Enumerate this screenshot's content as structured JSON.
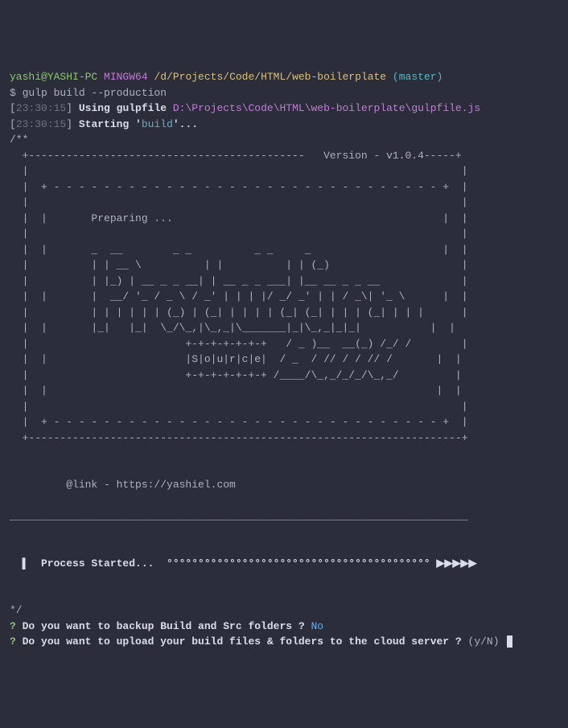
{
  "prompt": {
    "user": "yashi@YASHI-PC",
    "env": "MINGW64",
    "cwd": "/d/Projects/Code/HTML/web-boilerplate",
    "branch_open": "(",
    "branch": "master",
    "branch_close": ")"
  },
  "command": {
    "symbol": "$ ",
    "text": "gulp build --production"
  },
  "log1": {
    "lb": "[",
    "time": "23:30:15",
    "rb": "] ",
    "msg": "Using gulpfile ",
    "path": "D:\\Projects\\Code\\HTML\\web-boilerplate\\gulpfile.js"
  },
  "log2": {
    "lb": "[",
    "time": "23:30:15",
    "rb": "] ",
    "start": "Starting '",
    "task": "build",
    "end": "'..."
  },
  "ascii": {
    "open": "/**",
    "l01": "  +--------------------------------------------   Version - v1.0.4-----+",
    "l02": "  |                                                                     |",
    "l03": "  |  + - - - - - - - - - - - - - - - - - - - - - - - - - - - - - - - +  |",
    "l04": "  |                                                                     |",
    "l05": "  |  |       Preparing ...                                           |  |",
    "l06": "  |                                                                     |",
    "l07": "  |  |       _  __        _ _          _ _     _                     |  |",
    "l08": "  |          | | __ \\          | |          | | (_)                     |",
    "l09": "  |          | |_) | __ _ _ __| | __ _ _ ___| |__ __ _ _ __             |",
    "l10": "  |  |       |  __/ '_ / _ \\ / _' | | | |/ _/ _' | | / _\\| '_ \\      |  |",
    "l11": "  |          | | | | | | (_) | (_| | | | | (_| (_| | | | (_| | | |      |",
    "l12": "  |  |       |_|   |_|  \\_/\\_,|\\_,_|\\_______|_|\\_,_|_|_|           |  |",
    "l13": "  |                         +-+-+-+-+-+-+   / _ )__  __(_) /_/ /        |",
    "l14": "  |  |                      |S|o|u|r|c|e|  / _  / // / / // /       |  |",
    "l15": "  |                         +-+-+-+-+-+-+ /____/\\_,_/_/_/\\_,_/         |",
    "l16": "  |  |                                                              |  |",
    "l17": "  |                                                                     |",
    "l18": "  |  + - - - - - - - - - - - - - - - - - - - - - - - - - - - - - - - +  |",
    "l19": "  +---------------------------------------------------------------------+",
    "blank1": "",
    "link": "         @link - https://yashiel.com",
    "blank2": "",
    "divider": "_________________________________________________________________________",
    "blank3": "",
    "process": "  ▌  Process Started...  °°°°°°°°°°°°°°°°°°°°°°°°°°°°°°°°°°°°°°°°°° ▶▶▶▶▶",
    "blank4": "",
    "blank5": "",
    "close": "*/"
  },
  "q1": {
    "prefix": "?",
    "text": " Do you want to backup Build and Src folders ? ",
    "answer": "No"
  },
  "q2": {
    "prefix": "?",
    "text": " Do you want to upload your build files & folders to the cloud server ? ",
    "hint": "(y/N) "
  }
}
